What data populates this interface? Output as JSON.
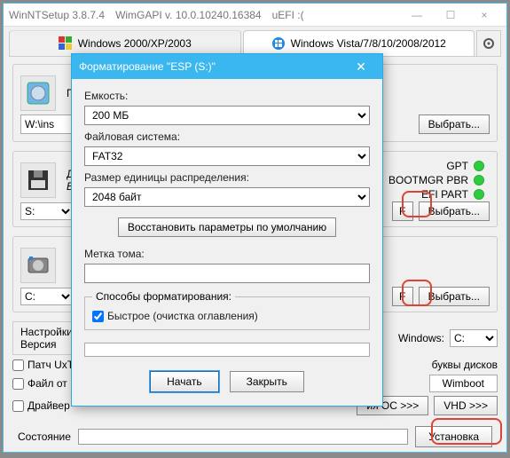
{
  "window": {
    "title_app": "WinNTSetup 3.8.7.4",
    "title_api": "WimGAPI v. 10.0.10240.16384",
    "title_efi": "uEFI :(",
    "min": "—",
    "max": "☐",
    "close": "×"
  },
  "tabs": {
    "left": "Windows 2000/XP/2003",
    "right": "Windows Vista/7/8/10/2008/2012"
  },
  "section1": {
    "label_prefix": "Пу",
    "path": "W:\\ins",
    "browse": "Выбрать..."
  },
  "section2": {
    "label_prefix": "Ди",
    "sub": "ES",
    "drive": "S:",
    "f": "F",
    "browse": "Выбрать...",
    "lights": {
      "gpt": "GPT",
      "bootmgr": "BOOTMGR PBR",
      "efipart": "EFI PART"
    }
  },
  "section3": {
    "drive": "C:",
    "f": "F",
    "browse": "Выбрать..."
  },
  "options": {
    "settings": "Настройки",
    "version": "Версия",
    "patch": "Патч UxT",
    "fileot": "Файл от",
    "drivers": "Драйвер",
    "windows_lbl": "Windows:",
    "windows_val": "C:",
    "drives_lbl": "буквы дисков",
    "wimboot": "Wimboot",
    "os_btn": "ия OC >>>",
    "vhd_btn": "VHD >>>"
  },
  "footer": {
    "state": "Состояние",
    "install": "Установка"
  },
  "dialog": {
    "title": "Форматирование \"ESP (S:)\"",
    "close": "✕",
    "capacity_lbl": "Емкость:",
    "capacity_val": "200 МБ",
    "fs_lbl": "Файловая система:",
    "fs_val": "FAT32",
    "alloc_lbl": "Размер единицы распределения:",
    "alloc_val": "2048 байт",
    "restore": "Восстановить параметры по умолчанию",
    "label_lbl": "Метка тома:",
    "label_val": "",
    "methods_lbl": "Способы форматирования:",
    "quick": "Быстрое (очистка оглавления)",
    "start": "Начать",
    "cancel": "Закрыть"
  }
}
